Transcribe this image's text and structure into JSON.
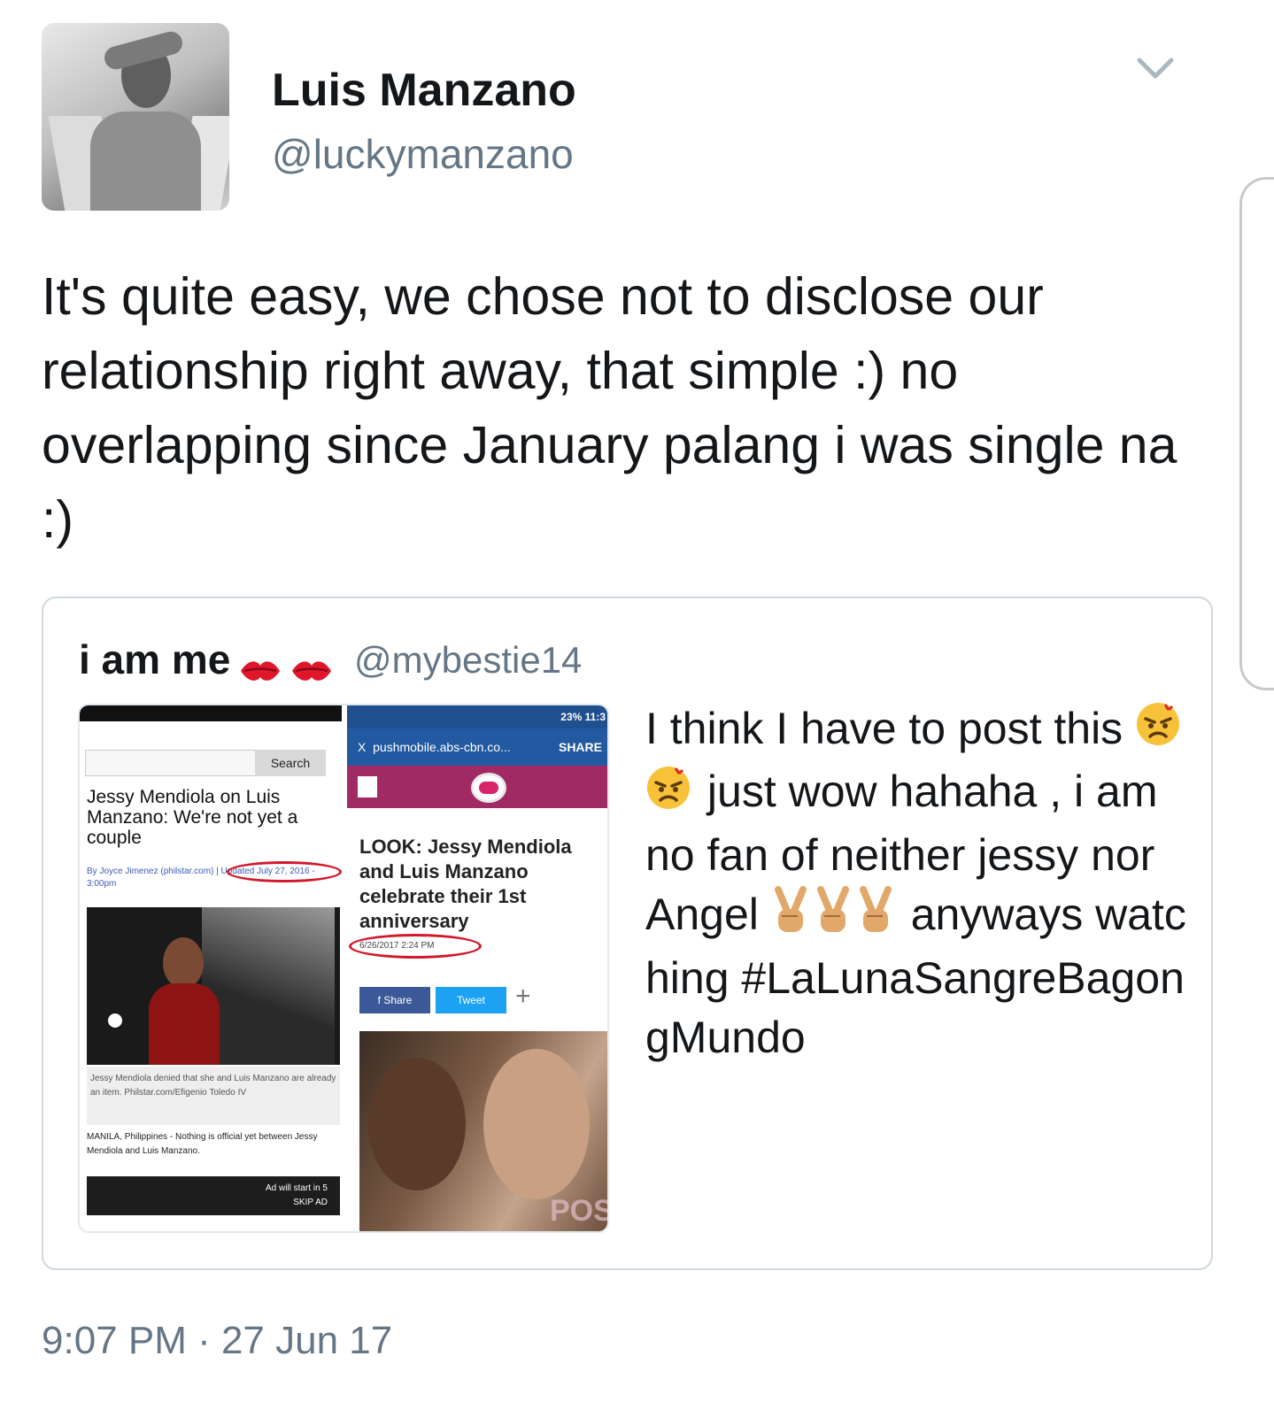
{
  "tweet": {
    "author_name": "Luis Manzano",
    "author_handle": "@luckymanzano",
    "text": "It's quite easy, we chose not to disclose our relationship right away, that simple :) no overlapping since January palang i was single na :)",
    "timestamp": "9:07 PM · 27 Jun 17",
    "menu_icon": "chevron-down-icon"
  },
  "quoted": {
    "author_name": "i am me",
    "author_handle": "@mybestie14",
    "name_emojis": [
      "kiss-mark-icon",
      "kiss-mark-icon"
    ],
    "text_part1": "I think I have to post this",
    "text_part2": "just wow hahaha , i am no fan of neither jessy nor Angel",
    "text_part3": "anyways watching #LaLunaSangreBagongMundo",
    "emojis_angry": [
      "angry-face-icon",
      "angry-face-icon"
    ],
    "emojis_victory": [
      "victory-hand-icon",
      "victory-hand-icon",
      "victory-hand-icon"
    ]
  },
  "media": {
    "left": {
      "search_label": "Search",
      "headline": "Jessy Mendiola on Luis Manzano: We're not yet a couple",
      "byline": "By Joyce Jimenez (philstar.com) | Updated July 27, 2016 - 3:00pm",
      "caption": "Jessy Mendiola denied that she and Luis Manzano are already an item. Philstar.com/Efigenio Toledo IV",
      "body": "MANILA, Philippines - Nothing is official yet between Jessy Mendiola and Luis Manzano.",
      "ad_line1": "Ad will start in 5",
      "ad_line2": "SKIP AD"
    },
    "right": {
      "status": "23% 11:3",
      "url": "pushmobile.abs-cbn.co...",
      "share": "SHARE",
      "close": "X",
      "headline": "LOOK: Jessy Mendiola and Luis Manzano celebrate their 1st anniversary",
      "date": "6/26/2017 2:24 PM",
      "fb_share": "Share",
      "tw_tweet": "Tweet",
      "plus": "+",
      "watermark": "POS"
    }
  },
  "colors": {
    "text": "#14171a",
    "secondary": "#657786",
    "border": "#cfd9de"
  }
}
